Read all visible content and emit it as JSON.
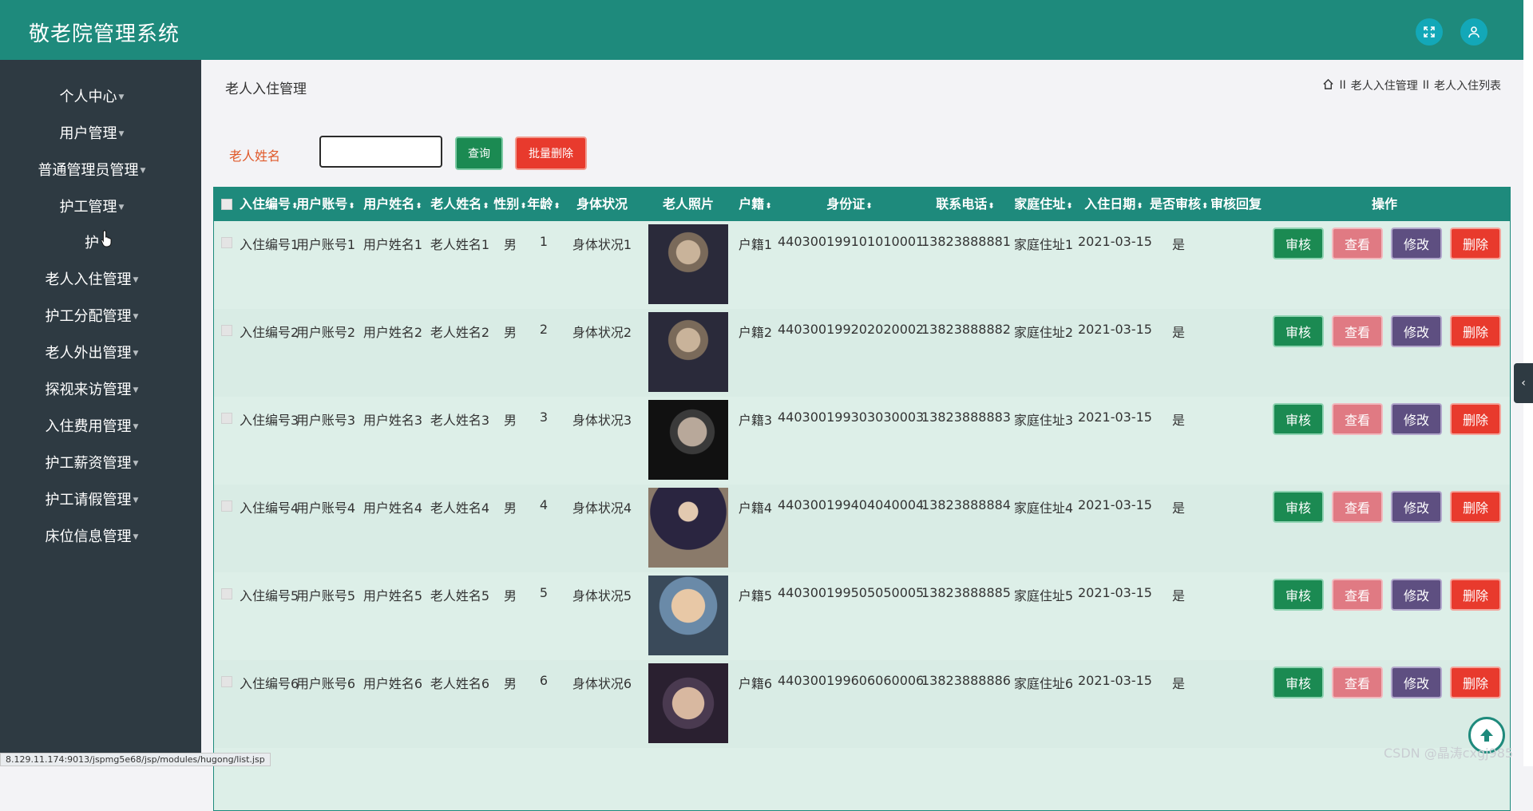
{
  "app": {
    "title": "敬老院管理系统"
  },
  "sidebar": {
    "items": [
      {
        "label": "个人中心"
      },
      {
        "label": "用户管理"
      },
      {
        "label": "普通管理员管理"
      },
      {
        "label": "护工管理"
      },
      {
        "label": "护"
      },
      {
        "label": "老人入住管理"
      },
      {
        "label": "护工分配管理"
      },
      {
        "label": "老人外出管理"
      },
      {
        "label": "探视来访管理"
      },
      {
        "label": "入住费用管理"
      },
      {
        "label": "护工薪资管理"
      },
      {
        "label": "护工请假管理"
      },
      {
        "label": "床位信息管理"
      }
    ]
  },
  "page": {
    "title": "老人入住管理"
  },
  "breadcrumb": {
    "sep1": "II",
    "item1": "老人入住管理",
    "sep2": "II",
    "item2": "老人入住列表"
  },
  "filter": {
    "label": "老人姓名",
    "input_value": "",
    "query_label": "查询",
    "batch_delete_label": "批量删除"
  },
  "table": {
    "headers": [
      "入住编号",
      "用户账号",
      "用户姓名",
      "老人姓名",
      "性别",
      "年龄",
      "身体状况",
      "老人照片",
      "户籍",
      "身份证",
      "联系电话",
      "家庭住址",
      "入住日期",
      "是否审核",
      "审核回复",
      "操作"
    ],
    "sort_glyph": "⬍",
    "actions": {
      "audit": "审核",
      "view": "查看",
      "edit": "修改",
      "delete": "删除"
    },
    "rows": [
      {
        "id": "入住编号1",
        "account": "用户账号1",
        "username": "用户姓名1",
        "elder": "老人姓名1",
        "gender": "男",
        "age": "1",
        "health": "身体状况1",
        "hukou": "户籍1",
        "idcard": "440300199101010001",
        "phone": "13823888881",
        "address": "家庭住址1",
        "date": "2021-03-15",
        "audited": "是",
        "reply": ""
      },
      {
        "id": "入住编号2",
        "account": "用户账号2",
        "username": "用户姓名2",
        "elder": "老人姓名2",
        "gender": "男",
        "age": "2",
        "health": "身体状况2",
        "hukou": "户籍2",
        "idcard": "440300199202020002",
        "phone": "13823888882",
        "address": "家庭住址2",
        "date": "2021-03-15",
        "audited": "是",
        "reply": ""
      },
      {
        "id": "入住编号3",
        "account": "用户账号3",
        "username": "用户姓名3",
        "elder": "老人姓名3",
        "gender": "男",
        "age": "3",
        "health": "身体状况3",
        "hukou": "户籍3",
        "idcard": "440300199303030003",
        "phone": "13823888883",
        "address": "家庭住址3",
        "date": "2021-03-15",
        "audited": "是",
        "reply": ""
      },
      {
        "id": "入住编号4",
        "account": "用户账号4",
        "username": "用户姓名4",
        "elder": "老人姓名4",
        "gender": "男",
        "age": "4",
        "health": "身体状况4",
        "hukou": "户籍4",
        "idcard": "440300199404040004",
        "phone": "13823888884",
        "address": "家庭住址4",
        "date": "2021-03-15",
        "audited": "是",
        "reply": ""
      },
      {
        "id": "入住编号5",
        "account": "用户账号5",
        "username": "用户姓名5",
        "elder": "老人姓名5",
        "gender": "男",
        "age": "5",
        "health": "身体状况5",
        "hukou": "户籍5",
        "idcard": "440300199505050005",
        "phone": "13823888885",
        "address": "家庭住址5",
        "date": "2021-03-15",
        "audited": "是",
        "reply": ""
      },
      {
        "id": "入住编号6",
        "account": "用户账号6",
        "username": "用户姓名6",
        "elder": "老人姓名6",
        "gender": "男",
        "age": "6",
        "health": "身体状况6",
        "hukou": "户籍6",
        "idcard": "440300199606060006",
        "phone": "13823888886",
        "address": "家庭住址6",
        "date": "2021-03-15",
        "audited": "是",
        "reply": ""
      }
    ]
  },
  "status_bar": {
    "url": "8.129.11.174:9013/jspmg5e68/jsp/modules/hugong/list.jsp"
  },
  "watermark": "CSDN @晶涛cxgj985",
  "colors": {
    "header": "#1e8a7c",
    "sidebar": "#2e3a42",
    "audit": "#1b8a52",
    "view": "#e07a83",
    "edit": "#5e4f81",
    "delete": "#e83a2d"
  }
}
